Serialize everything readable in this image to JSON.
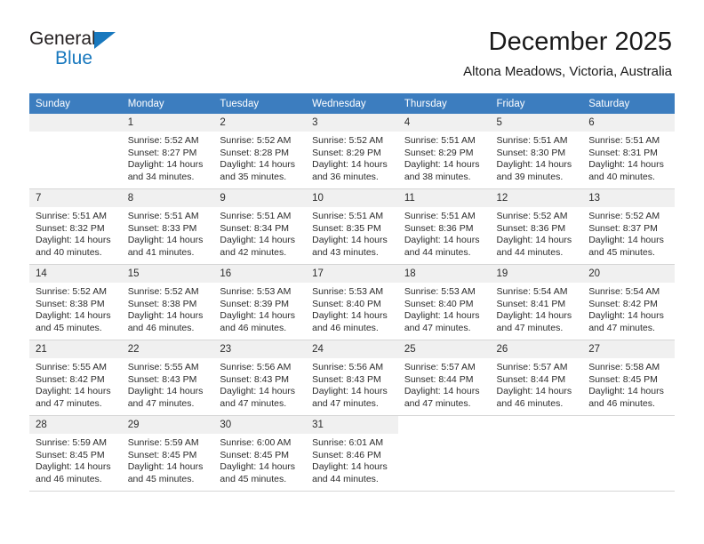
{
  "brand": {
    "name_top": "General",
    "name_bottom": "Blue",
    "triangle_icon": "brand-triangle-icon",
    "accent_color": "#1878BE"
  },
  "header": {
    "title": "December 2025",
    "subtitle": "Altona Meadows, Victoria, Australia"
  },
  "colors": {
    "header_row_bg": "#3C7DBF",
    "daynum_bg": "#F0F0F0",
    "grid_line": "#D6D6D6",
    "text": "#2B2B2B"
  },
  "weekday_headers": [
    "Sunday",
    "Monday",
    "Tuesday",
    "Wednesday",
    "Thursday",
    "Friday",
    "Saturday"
  ],
  "labels": {
    "sunrise_prefix": "Sunrise:",
    "sunset_prefix": "Sunset:",
    "daylight_prefix": "Daylight:"
  },
  "weeks": [
    [
      {
        "day": "",
        "blank": true
      },
      {
        "day": "1",
        "sunrise": "Sunrise: 5:52 AM",
        "sunset": "Sunset: 8:27 PM",
        "daylight": "Daylight: 14 hours and 34 minutes."
      },
      {
        "day": "2",
        "sunrise": "Sunrise: 5:52 AM",
        "sunset": "Sunset: 8:28 PM",
        "daylight": "Daylight: 14 hours and 35 minutes."
      },
      {
        "day": "3",
        "sunrise": "Sunrise: 5:52 AM",
        "sunset": "Sunset: 8:29 PM",
        "daylight": "Daylight: 14 hours and 36 minutes."
      },
      {
        "day": "4",
        "sunrise": "Sunrise: 5:51 AM",
        "sunset": "Sunset: 8:29 PM",
        "daylight": "Daylight: 14 hours and 38 minutes."
      },
      {
        "day": "5",
        "sunrise": "Sunrise: 5:51 AM",
        "sunset": "Sunset: 8:30 PM",
        "daylight": "Daylight: 14 hours and 39 minutes."
      },
      {
        "day": "6",
        "sunrise": "Sunrise: 5:51 AM",
        "sunset": "Sunset: 8:31 PM",
        "daylight": "Daylight: 14 hours and 40 minutes."
      }
    ],
    [
      {
        "day": "7",
        "sunrise": "Sunrise: 5:51 AM",
        "sunset": "Sunset: 8:32 PM",
        "daylight": "Daylight: 14 hours and 40 minutes."
      },
      {
        "day": "8",
        "sunrise": "Sunrise: 5:51 AM",
        "sunset": "Sunset: 8:33 PM",
        "daylight": "Daylight: 14 hours and 41 minutes."
      },
      {
        "day": "9",
        "sunrise": "Sunrise: 5:51 AM",
        "sunset": "Sunset: 8:34 PM",
        "daylight": "Daylight: 14 hours and 42 minutes."
      },
      {
        "day": "10",
        "sunrise": "Sunrise: 5:51 AM",
        "sunset": "Sunset: 8:35 PM",
        "daylight": "Daylight: 14 hours and 43 minutes."
      },
      {
        "day": "11",
        "sunrise": "Sunrise: 5:51 AM",
        "sunset": "Sunset: 8:36 PM",
        "daylight": "Daylight: 14 hours and 44 minutes."
      },
      {
        "day": "12",
        "sunrise": "Sunrise: 5:52 AM",
        "sunset": "Sunset: 8:36 PM",
        "daylight": "Daylight: 14 hours and 44 minutes."
      },
      {
        "day": "13",
        "sunrise": "Sunrise: 5:52 AM",
        "sunset": "Sunset: 8:37 PM",
        "daylight": "Daylight: 14 hours and 45 minutes."
      }
    ],
    [
      {
        "day": "14",
        "sunrise": "Sunrise: 5:52 AM",
        "sunset": "Sunset: 8:38 PM",
        "daylight": "Daylight: 14 hours and 45 minutes."
      },
      {
        "day": "15",
        "sunrise": "Sunrise: 5:52 AM",
        "sunset": "Sunset: 8:38 PM",
        "daylight": "Daylight: 14 hours and 46 minutes."
      },
      {
        "day": "16",
        "sunrise": "Sunrise: 5:53 AM",
        "sunset": "Sunset: 8:39 PM",
        "daylight": "Daylight: 14 hours and 46 minutes."
      },
      {
        "day": "17",
        "sunrise": "Sunrise: 5:53 AM",
        "sunset": "Sunset: 8:40 PM",
        "daylight": "Daylight: 14 hours and 46 minutes."
      },
      {
        "day": "18",
        "sunrise": "Sunrise: 5:53 AM",
        "sunset": "Sunset: 8:40 PM",
        "daylight": "Daylight: 14 hours and 47 minutes."
      },
      {
        "day": "19",
        "sunrise": "Sunrise: 5:54 AM",
        "sunset": "Sunset: 8:41 PM",
        "daylight": "Daylight: 14 hours and 47 minutes."
      },
      {
        "day": "20",
        "sunrise": "Sunrise: 5:54 AM",
        "sunset": "Sunset: 8:42 PM",
        "daylight": "Daylight: 14 hours and 47 minutes."
      }
    ],
    [
      {
        "day": "21",
        "sunrise": "Sunrise: 5:55 AM",
        "sunset": "Sunset: 8:42 PM",
        "daylight": "Daylight: 14 hours and 47 minutes."
      },
      {
        "day": "22",
        "sunrise": "Sunrise: 5:55 AM",
        "sunset": "Sunset: 8:43 PM",
        "daylight": "Daylight: 14 hours and 47 minutes."
      },
      {
        "day": "23",
        "sunrise": "Sunrise: 5:56 AM",
        "sunset": "Sunset: 8:43 PM",
        "daylight": "Daylight: 14 hours and 47 minutes."
      },
      {
        "day": "24",
        "sunrise": "Sunrise: 5:56 AM",
        "sunset": "Sunset: 8:43 PM",
        "daylight": "Daylight: 14 hours and 47 minutes."
      },
      {
        "day": "25",
        "sunrise": "Sunrise: 5:57 AM",
        "sunset": "Sunset: 8:44 PM",
        "daylight": "Daylight: 14 hours and 47 minutes."
      },
      {
        "day": "26",
        "sunrise": "Sunrise: 5:57 AM",
        "sunset": "Sunset: 8:44 PM",
        "daylight": "Daylight: 14 hours and 46 minutes."
      },
      {
        "day": "27",
        "sunrise": "Sunrise: 5:58 AM",
        "sunset": "Sunset: 8:45 PM",
        "daylight": "Daylight: 14 hours and 46 minutes."
      }
    ],
    [
      {
        "day": "28",
        "sunrise": "Sunrise: 5:59 AM",
        "sunset": "Sunset: 8:45 PM",
        "daylight": "Daylight: 14 hours and 46 minutes."
      },
      {
        "day": "29",
        "sunrise": "Sunrise: 5:59 AM",
        "sunset": "Sunset: 8:45 PM",
        "daylight": "Daylight: 14 hours and 45 minutes."
      },
      {
        "day": "30",
        "sunrise": "Sunrise: 6:00 AM",
        "sunset": "Sunset: 8:45 PM",
        "daylight": "Daylight: 14 hours and 45 minutes."
      },
      {
        "day": "31",
        "sunrise": "Sunrise: 6:01 AM",
        "sunset": "Sunset: 8:46 PM",
        "daylight": "Daylight: 14 hours and 44 minutes."
      },
      {
        "day": "",
        "blank": true
      },
      {
        "day": "",
        "blank": true
      },
      {
        "day": "",
        "blank": true
      }
    ]
  ]
}
